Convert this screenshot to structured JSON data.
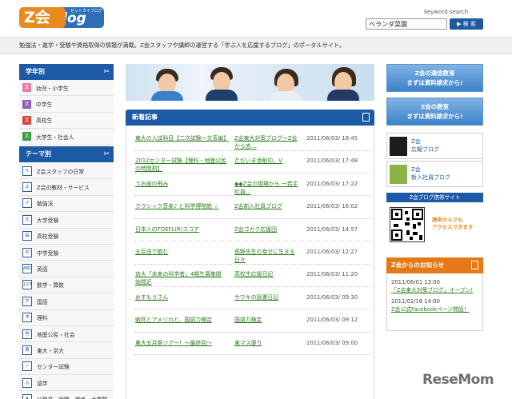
{
  "header": {
    "logo_main": "Z会",
    "logo_blog": "blog",
    "logo_sub": "ゼットカイブログ",
    "search_label": "keyword search",
    "search_value": "ベランダ菜園",
    "search_button": "▶ 検 索",
    "tagline": "勉強法・進学・受験や資格取得の情報が満載。Z会スタッフや講師の運営する「学ぶ人を応援するブログ」のポータルサイト。"
  },
  "grade": {
    "title": "学年別",
    "toggle": "✂",
    "items": [
      {
        "badge": "文",
        "color": "#e879a8",
        "label": "幼児・小学生"
      },
      {
        "badge": "文",
        "color": "#8a5fb8",
        "label": "中学生"
      },
      {
        "badge": "文",
        "color": "#d9453a",
        "label": "高校生"
      },
      {
        "badge": "文",
        "color": "#3b9d45",
        "label": "大学生・社会人"
      }
    ]
  },
  "theme": {
    "title": "テーマ別",
    "toggle": "✂",
    "items": [
      {
        "icon": "✎",
        "label": "Z会スタッフの日常"
      },
      {
        "icon": "Z",
        "label": "Z会の教材・サービス"
      },
      {
        "icon": "✐",
        "label": "勉強法"
      },
      {
        "icon": "大",
        "label": "大学受験"
      },
      {
        "icon": "高",
        "label": "高校受験"
      },
      {
        "icon": "中",
        "label": "中学受験"
      },
      {
        "icon": "ABC",
        "label": "英語"
      },
      {
        "icon": "123",
        "label": "数学・算数"
      },
      {
        "icon": "文",
        "label": "国語"
      },
      {
        "icon": "⚗",
        "label": "理科"
      },
      {
        "icon": "地",
        "label": "地歴公民・社会"
      },
      {
        "icon": "東",
        "label": "東大・京大"
      },
      {
        "icon": "✓",
        "label": "センター試験"
      },
      {
        "icon": "◎",
        "label": "語学"
      },
      {
        "icon": "♟",
        "label": "公務員・就職・資格・大学院"
      }
    ]
  },
  "news": {
    "title": "新着記事",
    "rows": [
      {
        "title": "東大の入試科目【二次試験〜文系編】",
        "blog": "Z会東大対策ブログ〜Z会から赤…",
        "date": "2011/06/03/ 18:45"
      },
      {
        "title": "2012センター試験【理科・地歴公民の時間割】",
        "blog": "ただいま添削中。V",
        "date": "2011/06/03/ 17:48"
      },
      {
        "title": "うお座の飛み",
        "blog": "◆◆Z会の現場から 一若手社員…",
        "date": "2011/06/03/ 17:22"
      },
      {
        "title": "クラシック音楽♪ と科学博物館 ☆",
        "blog": "Z会新入社員ブログ",
        "date": "2011/06/03/ 16:02"
      },
      {
        "title": "日本人のTOEFL(R)スコア",
        "blog": "Z会ゴガク応援団",
        "date": "2011/06/03/ 14:57"
      },
      {
        "title": "五反田で飲む",
        "blog": "長野先生の幸せに生きる日々",
        "date": "2011/06/03/ 12:27"
      },
      {
        "title": "京大「未来の科学者」4期生募集開始間近",
        "blog": "高校生応援日記",
        "date": "2011/06/03/ 11:20"
      },
      {
        "title": "おすもうさん",
        "blog": "サワキの読書日記",
        "date": "2011/06/03/ 09:30"
      },
      {
        "title": "戦死とアメリカと、国語力検定",
        "blog": "国語力検定",
        "date": "2011/06/03/ 09:12"
      },
      {
        "title": "東大五月祭ツアー！〜最終回〜",
        "blog": "東マス便り",
        "date": "2011/06/03/ 09:00"
      }
    ]
  },
  "right": {
    "btn1": [
      "Z会の通信教育",
      "まずは資料請求から!"
    ],
    "btn2": [
      "Z会の教室",
      "まずは資料請求から!"
    ],
    "box1": [
      "Z会",
      "広報ブログ"
    ],
    "box2": [
      "Z会",
      "新入社員ブログ"
    ],
    "mobile": "Z会ブログ携帯サイト",
    "qr_text": [
      "携帯からでも",
      "アクセスできます"
    ],
    "notice_title": "Z会からのお知らせ",
    "notices": [
      {
        "date": "2011/06/01 13:00",
        "text": "「Z会東大対策ブログ」オープン!"
      },
      {
        "date": "2011/02/16 14:00",
        "text": "Z会公式Facebookページ開設！"
      }
    ]
  },
  "watermark": "ReseMom"
}
